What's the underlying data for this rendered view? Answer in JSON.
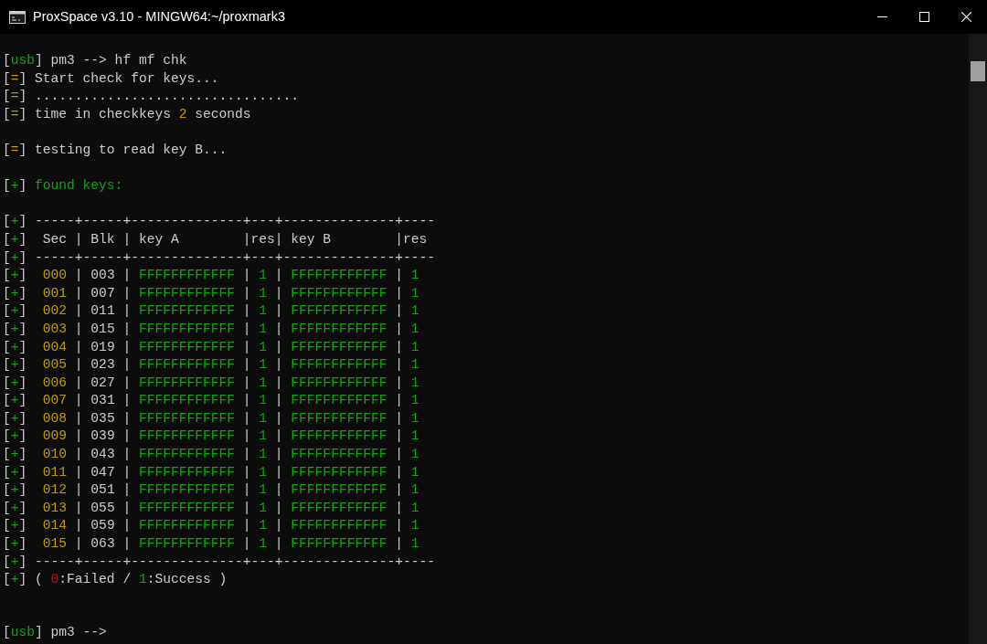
{
  "window": {
    "title": "ProxSpace v3.10 - MINGW64:~/proxmark3"
  },
  "terminal": {
    "blocks": [
      {
        "lines": [
          [
            {
              "text": "["
            },
            {
              "text": "usb",
              "color": "#13a10e"
            },
            {
              "text": "] pm3 --> hf mf chk"
            }
          ],
          [
            {
              "text": "["
            },
            {
              "text": "=",
              "color": "#c19c00"
            },
            {
              "text": "] Start check for keys..."
            }
          ],
          [
            {
              "text": "["
            },
            {
              "text": "=",
              "color": "#c19c00"
            },
            {
              "text": "] ................................."
            }
          ],
          [
            {
              "text": "["
            },
            {
              "text": "=",
              "color": "#c19c00"
            },
            {
              "text": "] time in checkkeys "
            },
            {
              "text": "2",
              "color": "#c19c00"
            },
            {
              "text": " seconds"
            }
          ]
        ]
      },
      {
        "lines": [
          [
            {
              "text": "["
            },
            {
              "text": "=",
              "color": "#c19c00"
            },
            {
              "text": "] testing to read key B..."
            }
          ]
        ]
      },
      {
        "lines": [
          [
            {
              "text": "["
            },
            {
              "text": "+",
              "color": "#13a10e"
            },
            {
              "text": "] "
            },
            {
              "text": "found keys:",
              "color": "#13a10e"
            }
          ]
        ]
      },
      {
        "lines": [
          [
            {
              "text": "["
            },
            {
              "text": "+",
              "color": "#13a10e"
            },
            {
              "text": "] -----+-----+--------------+---+--------------+----"
            }
          ],
          [
            {
              "text": "["
            },
            {
              "text": "+",
              "color": "#13a10e"
            },
            {
              "text": "]  Sec | Blk | key A        |res| key B        |res"
            }
          ],
          [
            {
              "text": "["
            },
            {
              "text": "+",
              "color": "#13a10e"
            },
            {
              "text": "] -----+-----+--------------+---+--------------+----"
            }
          ],
          [
            {
              "text": "["
            },
            {
              "text": "+",
              "color": "#13a10e"
            },
            {
              "text": "]  "
            },
            {
              "text": "000",
              "color": "#c19c00"
            },
            {
              "text": " | 003 | "
            },
            {
              "text": "FFFFFFFFFFFF",
              "color": "#13a10e"
            },
            {
              "text": " | "
            },
            {
              "text": "1",
              "color": "#13a10e"
            },
            {
              "text": " | "
            },
            {
              "text": "FFFFFFFFFFFF",
              "color": "#13a10e"
            },
            {
              "text": " | "
            },
            {
              "text": "1",
              "color": "#13a10e"
            }
          ],
          [
            {
              "text": "["
            },
            {
              "text": "+",
              "color": "#13a10e"
            },
            {
              "text": "]  "
            },
            {
              "text": "001",
              "color": "#c19c00"
            },
            {
              "text": " | 007 | "
            },
            {
              "text": "FFFFFFFFFFFF",
              "color": "#13a10e"
            },
            {
              "text": " | "
            },
            {
              "text": "1",
              "color": "#13a10e"
            },
            {
              "text": " | "
            },
            {
              "text": "FFFFFFFFFFFF",
              "color": "#13a10e"
            },
            {
              "text": " | "
            },
            {
              "text": "1",
              "color": "#13a10e"
            }
          ],
          [
            {
              "text": "["
            },
            {
              "text": "+",
              "color": "#13a10e"
            },
            {
              "text": "]  "
            },
            {
              "text": "002",
              "color": "#c19c00"
            },
            {
              "text": " | 011 | "
            },
            {
              "text": "FFFFFFFFFFFF",
              "color": "#13a10e"
            },
            {
              "text": " | "
            },
            {
              "text": "1",
              "color": "#13a10e"
            },
            {
              "text": " | "
            },
            {
              "text": "FFFFFFFFFFFF",
              "color": "#13a10e"
            },
            {
              "text": " | "
            },
            {
              "text": "1",
              "color": "#13a10e"
            }
          ],
          [
            {
              "text": "["
            },
            {
              "text": "+",
              "color": "#13a10e"
            },
            {
              "text": "]  "
            },
            {
              "text": "003",
              "color": "#c19c00"
            },
            {
              "text": " | 015 | "
            },
            {
              "text": "FFFFFFFFFFFF",
              "color": "#13a10e"
            },
            {
              "text": " | "
            },
            {
              "text": "1",
              "color": "#13a10e"
            },
            {
              "text": " | "
            },
            {
              "text": "FFFFFFFFFFFF",
              "color": "#13a10e"
            },
            {
              "text": " | "
            },
            {
              "text": "1",
              "color": "#13a10e"
            }
          ],
          [
            {
              "text": "["
            },
            {
              "text": "+",
              "color": "#13a10e"
            },
            {
              "text": "]  "
            },
            {
              "text": "004",
              "color": "#c19c00"
            },
            {
              "text": " | 019 | "
            },
            {
              "text": "FFFFFFFFFFFF",
              "color": "#13a10e"
            },
            {
              "text": " | "
            },
            {
              "text": "1",
              "color": "#13a10e"
            },
            {
              "text": " | "
            },
            {
              "text": "FFFFFFFFFFFF",
              "color": "#13a10e"
            },
            {
              "text": " | "
            },
            {
              "text": "1",
              "color": "#13a10e"
            }
          ],
          [
            {
              "text": "["
            },
            {
              "text": "+",
              "color": "#13a10e"
            },
            {
              "text": "]  "
            },
            {
              "text": "005",
              "color": "#c19c00"
            },
            {
              "text": " | 023 | "
            },
            {
              "text": "FFFFFFFFFFFF",
              "color": "#13a10e"
            },
            {
              "text": " | "
            },
            {
              "text": "1",
              "color": "#13a10e"
            },
            {
              "text": " | "
            },
            {
              "text": "FFFFFFFFFFFF",
              "color": "#13a10e"
            },
            {
              "text": " | "
            },
            {
              "text": "1",
              "color": "#13a10e"
            }
          ],
          [
            {
              "text": "["
            },
            {
              "text": "+",
              "color": "#13a10e"
            },
            {
              "text": "]  "
            },
            {
              "text": "006",
              "color": "#c19c00"
            },
            {
              "text": " | 027 | "
            },
            {
              "text": "FFFFFFFFFFFF",
              "color": "#13a10e"
            },
            {
              "text": " | "
            },
            {
              "text": "1",
              "color": "#13a10e"
            },
            {
              "text": " | "
            },
            {
              "text": "FFFFFFFFFFFF",
              "color": "#13a10e"
            },
            {
              "text": " | "
            },
            {
              "text": "1",
              "color": "#13a10e"
            }
          ],
          [
            {
              "text": "["
            },
            {
              "text": "+",
              "color": "#13a10e"
            },
            {
              "text": "]  "
            },
            {
              "text": "007",
              "color": "#c19c00"
            },
            {
              "text": " | 031 | "
            },
            {
              "text": "FFFFFFFFFFFF",
              "color": "#13a10e"
            },
            {
              "text": " | "
            },
            {
              "text": "1",
              "color": "#13a10e"
            },
            {
              "text": " | "
            },
            {
              "text": "FFFFFFFFFFFF",
              "color": "#13a10e"
            },
            {
              "text": " | "
            },
            {
              "text": "1",
              "color": "#13a10e"
            }
          ],
          [
            {
              "text": "["
            },
            {
              "text": "+",
              "color": "#13a10e"
            },
            {
              "text": "]  "
            },
            {
              "text": "008",
              "color": "#c19c00"
            },
            {
              "text": " | 035 | "
            },
            {
              "text": "FFFFFFFFFFFF",
              "color": "#13a10e"
            },
            {
              "text": " | "
            },
            {
              "text": "1",
              "color": "#13a10e"
            },
            {
              "text": " | "
            },
            {
              "text": "FFFFFFFFFFFF",
              "color": "#13a10e"
            },
            {
              "text": " | "
            },
            {
              "text": "1",
              "color": "#13a10e"
            }
          ],
          [
            {
              "text": "["
            },
            {
              "text": "+",
              "color": "#13a10e"
            },
            {
              "text": "]  "
            },
            {
              "text": "009",
              "color": "#c19c00"
            },
            {
              "text": " | 039 | "
            },
            {
              "text": "FFFFFFFFFFFF",
              "color": "#13a10e"
            },
            {
              "text": " | "
            },
            {
              "text": "1",
              "color": "#13a10e"
            },
            {
              "text": " | "
            },
            {
              "text": "FFFFFFFFFFFF",
              "color": "#13a10e"
            },
            {
              "text": " | "
            },
            {
              "text": "1",
              "color": "#13a10e"
            }
          ],
          [
            {
              "text": "["
            },
            {
              "text": "+",
              "color": "#13a10e"
            },
            {
              "text": "]  "
            },
            {
              "text": "010",
              "color": "#c19c00"
            },
            {
              "text": " | 043 | "
            },
            {
              "text": "FFFFFFFFFFFF",
              "color": "#13a10e"
            },
            {
              "text": " | "
            },
            {
              "text": "1",
              "color": "#13a10e"
            },
            {
              "text": " | "
            },
            {
              "text": "FFFFFFFFFFFF",
              "color": "#13a10e"
            },
            {
              "text": " | "
            },
            {
              "text": "1",
              "color": "#13a10e"
            }
          ],
          [
            {
              "text": "["
            },
            {
              "text": "+",
              "color": "#13a10e"
            },
            {
              "text": "]  "
            },
            {
              "text": "011",
              "color": "#c19c00"
            },
            {
              "text": " | 047 | "
            },
            {
              "text": "FFFFFFFFFFFF",
              "color": "#13a10e"
            },
            {
              "text": " | "
            },
            {
              "text": "1",
              "color": "#13a10e"
            },
            {
              "text": " | "
            },
            {
              "text": "FFFFFFFFFFFF",
              "color": "#13a10e"
            },
            {
              "text": " | "
            },
            {
              "text": "1",
              "color": "#13a10e"
            }
          ],
          [
            {
              "text": "["
            },
            {
              "text": "+",
              "color": "#13a10e"
            },
            {
              "text": "]  "
            },
            {
              "text": "012",
              "color": "#c19c00"
            },
            {
              "text": " | 051 | "
            },
            {
              "text": "FFFFFFFFFFFF",
              "color": "#13a10e"
            },
            {
              "text": " | "
            },
            {
              "text": "1",
              "color": "#13a10e"
            },
            {
              "text": " | "
            },
            {
              "text": "FFFFFFFFFFFF",
              "color": "#13a10e"
            },
            {
              "text": " | "
            },
            {
              "text": "1",
              "color": "#13a10e"
            }
          ],
          [
            {
              "text": "["
            },
            {
              "text": "+",
              "color": "#13a10e"
            },
            {
              "text": "]  "
            },
            {
              "text": "013",
              "color": "#c19c00"
            },
            {
              "text": " | 055 | "
            },
            {
              "text": "FFFFFFFFFFFF",
              "color": "#13a10e"
            },
            {
              "text": " | "
            },
            {
              "text": "1",
              "color": "#13a10e"
            },
            {
              "text": " | "
            },
            {
              "text": "FFFFFFFFFFFF",
              "color": "#13a10e"
            },
            {
              "text": " | "
            },
            {
              "text": "1",
              "color": "#13a10e"
            }
          ],
          [
            {
              "text": "["
            },
            {
              "text": "+",
              "color": "#13a10e"
            },
            {
              "text": "]  "
            },
            {
              "text": "014",
              "color": "#c19c00"
            },
            {
              "text": " | 059 | "
            },
            {
              "text": "FFFFFFFFFFFF",
              "color": "#13a10e"
            },
            {
              "text": " | "
            },
            {
              "text": "1",
              "color": "#13a10e"
            },
            {
              "text": " | "
            },
            {
              "text": "FFFFFFFFFFFF",
              "color": "#13a10e"
            },
            {
              "text": " | "
            },
            {
              "text": "1",
              "color": "#13a10e"
            }
          ],
          [
            {
              "text": "["
            },
            {
              "text": "+",
              "color": "#13a10e"
            },
            {
              "text": "]  "
            },
            {
              "text": "015",
              "color": "#c19c00"
            },
            {
              "text": " | 063 | "
            },
            {
              "text": "FFFFFFFFFFFF",
              "color": "#13a10e"
            },
            {
              "text": " | "
            },
            {
              "text": "1",
              "color": "#13a10e"
            },
            {
              "text": " | "
            },
            {
              "text": "FFFFFFFFFFFF",
              "color": "#13a10e"
            },
            {
              "text": " | "
            },
            {
              "text": "1",
              "color": "#13a10e"
            }
          ],
          [
            {
              "text": "["
            },
            {
              "text": "+",
              "color": "#13a10e"
            },
            {
              "text": "] -----+-----+--------------+---+--------------+----"
            }
          ],
          [
            {
              "text": "["
            },
            {
              "text": "+",
              "color": "#13a10e"
            },
            {
              "text": "] ( "
            },
            {
              "text": "0",
              "color": "#c50f1f"
            },
            {
              "text": ":Failed / "
            },
            {
              "text": "1",
              "color": "#13a10e"
            },
            {
              "text": ":Success )"
            }
          ]
        ]
      }
    ],
    "prompt": [
      {
        "text": "["
      },
      {
        "text": "usb",
        "color": "#13a10e"
      },
      {
        "text": "] pm3 -->"
      }
    ]
  }
}
